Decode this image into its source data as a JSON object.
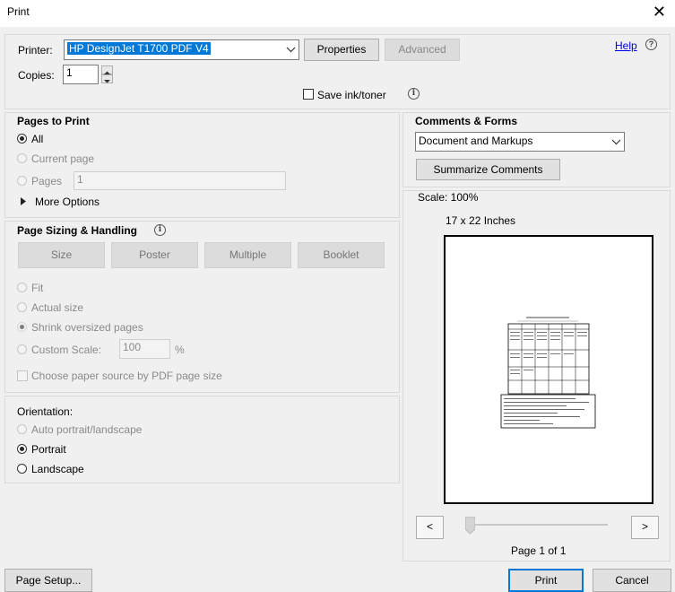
{
  "window": {
    "title": "Print",
    "close_glyph": "✕"
  },
  "printer": {
    "label": "Printer:",
    "selected": "HP DesignJet T1700 PDF V4",
    "properties_label": "Properties",
    "advanced_label": "Advanced",
    "help_label": "Help"
  },
  "copies": {
    "label": "Copies:",
    "value": "1"
  },
  "save_ink": {
    "label": "Save ink/toner"
  },
  "pages_to_print": {
    "title": "Pages to Print",
    "all": "All",
    "current": "Current page",
    "pages": "Pages",
    "pages_value": "1",
    "more_options": "More Options"
  },
  "page_sizing": {
    "title": "Page Sizing & Handling",
    "tabs": [
      "Size",
      "Poster",
      "Multiple",
      "Booklet"
    ],
    "fit": "Fit",
    "actual": "Actual size",
    "shrink": "Shrink oversized pages",
    "custom": "Custom Scale:",
    "custom_value": "100",
    "percent": "%",
    "paper_source": "Choose paper source by PDF page size"
  },
  "orientation": {
    "title": "Orientation:",
    "auto": "Auto portrait/landscape",
    "portrait": "Portrait",
    "landscape": "Landscape"
  },
  "comments": {
    "title": "Comments & Forms",
    "selected": "Document and Markups",
    "summarize_label": "Summarize Comments"
  },
  "preview": {
    "scale": "Scale: 100%",
    "paper": "17 x 22 Inches",
    "page_indicator": "Page 1 of 1",
    "prev": "<",
    "next": ">"
  },
  "footer": {
    "page_setup": "Page Setup...",
    "print": "Print",
    "cancel": "Cancel"
  },
  "colors": {
    "accent": "#0078d7",
    "link": "#0000ee",
    "highlight": "#0078d7"
  }
}
